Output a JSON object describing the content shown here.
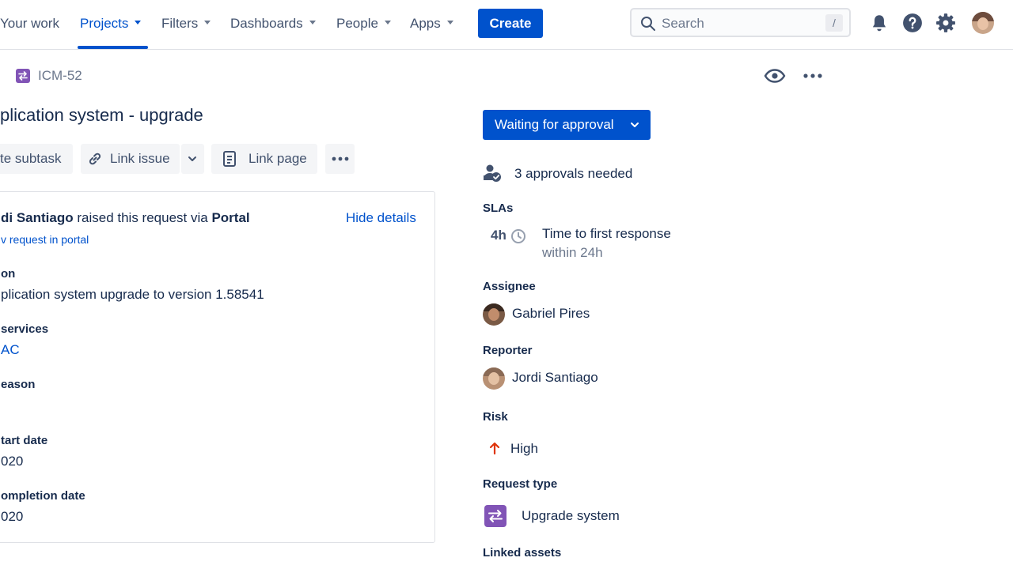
{
  "nav": {
    "your_work": "Your work",
    "projects": "Projects",
    "filters": "Filters",
    "dashboards": "Dashboards",
    "people": "People",
    "apps": "Apps",
    "create": "Create",
    "search_placeholder": "Search",
    "search_shortcut": "/",
    "icons": [
      "bell-icon",
      "help-icon",
      "gear-icon",
      "user-avatar"
    ]
  },
  "issue": {
    "key": "ICM-52",
    "title": "plication system - upgrade",
    "toolbar": {
      "create_subtask": "te subtask",
      "link_issue": "Link issue",
      "link_page": "Link page"
    },
    "details": {
      "raiser_name": "di Santiago",
      "raised_text": " raised this request via ",
      "channel": "Portal",
      "hide_details": "Hide details",
      "view_portal": "v request in portal",
      "fields": [
        {
          "label": "on",
          "value": "plication system upgrade to version 1.58541",
          "link": false
        },
        {
          "label": "services",
          "value": "AC",
          "link": true
        },
        {
          "label": "eason",
          "value": "",
          "link": false
        },
        {
          "label": "tart date",
          "value": "020",
          "link": false
        },
        {
          "label": "ompletion date",
          "value": "020",
          "link": false
        }
      ]
    }
  },
  "sidebar": {
    "status": "Waiting for approval",
    "approvals": "3 approvals needed",
    "slas_label": "SLAs",
    "sla_time": "4h",
    "sla_name": "Time to first response",
    "sla_target": "within 24h",
    "assignee_label": "Assignee",
    "assignee": "Gabriel Pires",
    "reporter_label": "Reporter",
    "reporter": "Jordi Santiago",
    "risk_label": "Risk",
    "risk": "High",
    "request_type_label": "Request type",
    "request_type": "Upgrade system",
    "linked_assets_label": "Linked assets"
  },
  "colors": {
    "primary": "#0052cc",
    "text": "#172b4d",
    "subtle": "#6b778c",
    "purple": "#8154b6",
    "risk_high": "#de350b"
  }
}
